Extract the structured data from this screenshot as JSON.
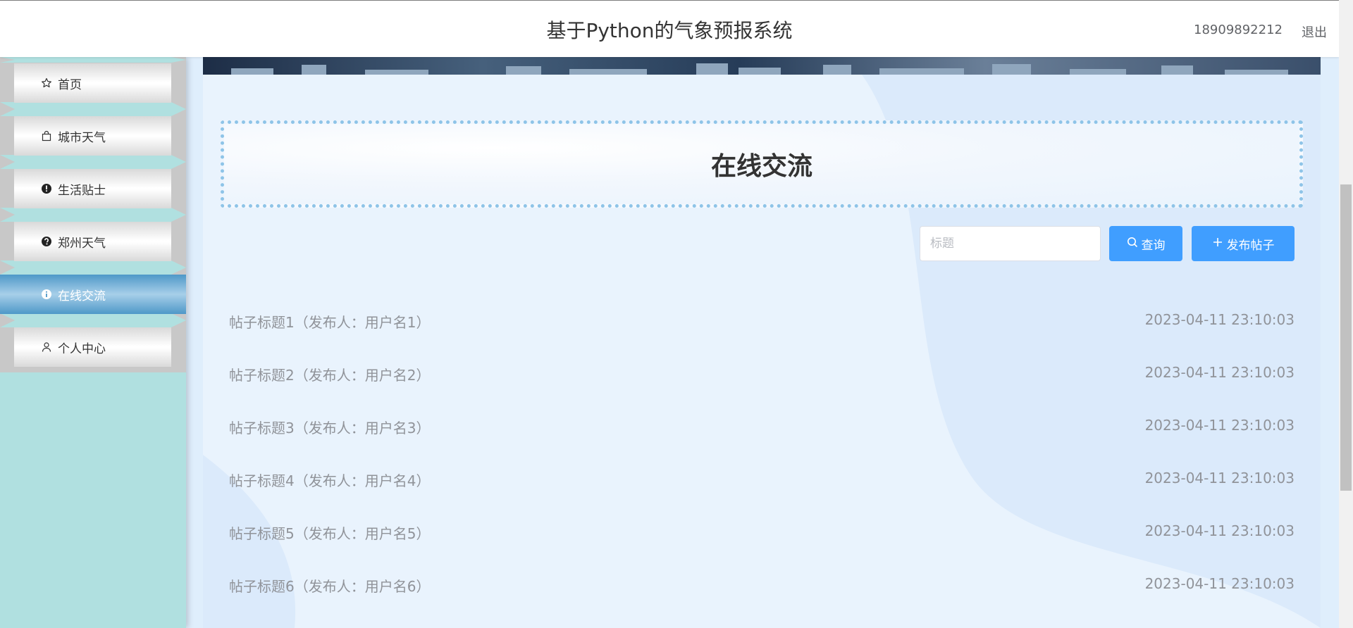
{
  "header": {
    "title": "基于Python的气象预报系统",
    "user_phone": "18909892212",
    "logout_label": "退出"
  },
  "sidebar": {
    "items": [
      {
        "label": "首页",
        "icon": "star-icon",
        "active": false
      },
      {
        "label": "城市天气",
        "icon": "shopping-bag-icon",
        "active": false
      },
      {
        "label": "生活贴士",
        "icon": "warning-circle-icon",
        "active": false
      },
      {
        "label": "郑州天气",
        "icon": "question-circle-icon",
        "active": false
      },
      {
        "label": "在线交流",
        "icon": "info-circle-icon",
        "active": true
      },
      {
        "label": "个人中心",
        "icon": "user-icon",
        "active": false
      }
    ]
  },
  "main": {
    "section_title": "在线交流",
    "search": {
      "placeholder": "标题"
    },
    "search_button_label": "查询",
    "publish_button_label": "发布帖子",
    "posts": [
      {
        "title": "帖子标题1（发布人：用户名1）",
        "time": "2023-04-11 23:10:03"
      },
      {
        "title": "帖子标题2（发布人：用户名2）",
        "time": "2023-04-11 23:10:03"
      },
      {
        "title": "帖子标题3（发布人：用户名3）",
        "time": "2023-04-11 23:10:03"
      },
      {
        "title": "帖子标题4（发布人：用户名4）",
        "time": "2023-04-11 23:10:03"
      },
      {
        "title": "帖子标题5（发布人：用户名5）",
        "time": "2023-04-11 23:10:03"
      },
      {
        "title": "帖子标题6（发布人：用户名6）",
        "time": "2023-04-11 23:10:03"
      }
    ]
  },
  "colors": {
    "primary": "#409eff",
    "sidebar_bg": "#b0e0e0",
    "active_item": "#4e98c8",
    "section_border": "#8ec4e8"
  }
}
